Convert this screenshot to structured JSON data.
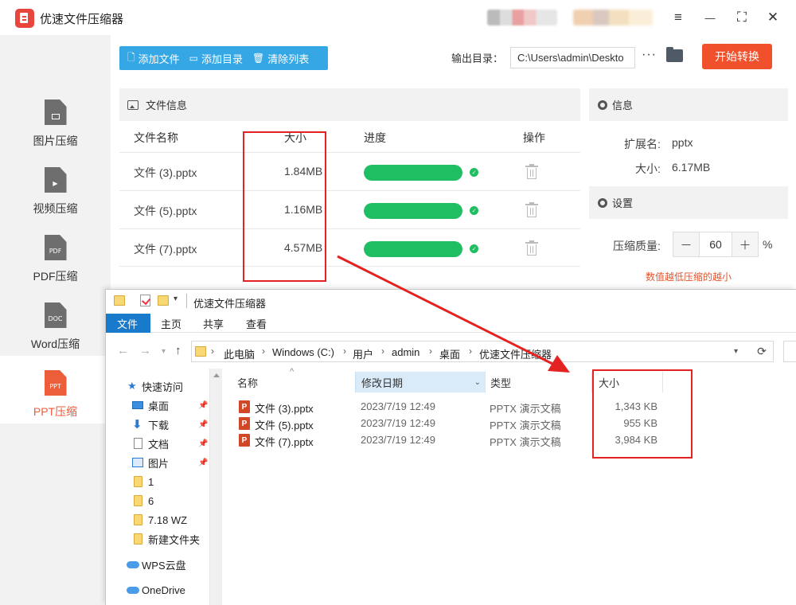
{
  "app": {
    "title": "优速文件压缩器",
    "window_controls": {
      "menu": "≡",
      "minimize": "—",
      "fullscreen": "⛶",
      "close": "✕"
    }
  },
  "sidebar": {
    "items": [
      {
        "label": "图片压缩",
        "icon": "image-file-icon",
        "tag": "",
        "active": false
      },
      {
        "label": "视频压缩",
        "icon": "video-file-icon",
        "tag": "▶",
        "active": false
      },
      {
        "label": "PDF压缩",
        "icon": "pdf-file-icon",
        "tag": "PDF",
        "active": false
      },
      {
        "label": "Word压缩",
        "icon": "word-file-icon",
        "tag": "DOC",
        "active": false
      },
      {
        "label": "PPT压缩",
        "icon": "ppt-file-icon",
        "tag": "PPT",
        "active": true
      }
    ]
  },
  "toolbar": {
    "add_file": "添加文件",
    "add_dir": "添加目录",
    "clear_list": "清除列表",
    "output_label": "输出目录：",
    "output_path": "C:\\Users\\admin\\Deskto",
    "more": "···",
    "start": "开始转换"
  },
  "file_panel": {
    "title": "文件信息",
    "columns": {
      "name": "文件名称",
      "size": "大小",
      "progress": "进度",
      "action": "操作"
    },
    "rows": [
      {
        "name": "文件 (3).pptx",
        "size": "1.84MB",
        "progress": 1.0
      },
      {
        "name": "文件 (5).pptx",
        "size": "1.16MB",
        "progress": 1.0
      },
      {
        "name": "文件 (7).pptx",
        "size": "4.57MB",
        "progress": 1.0
      }
    ]
  },
  "info_panel": {
    "title": "信息",
    "ext_label": "扩展名:",
    "ext_value": "pptx",
    "size_label": "大小:",
    "size_value": "6.17MB"
  },
  "settings_panel": {
    "title": "设置",
    "quality_label": "压缩质量:",
    "quality_value": "60",
    "minus": "－",
    "plus": "＋",
    "percent": "%",
    "hint": "数值越低压缩的越小"
  },
  "explorer": {
    "title": "优速文件压缩器",
    "ribbon_tabs": [
      "文件",
      "主页",
      "共享",
      "查看"
    ],
    "breadcrumb": [
      "此电脑",
      "Windows (C:)",
      "用户",
      "admin",
      "桌面",
      "优速文件压缩器"
    ],
    "nav_items": [
      {
        "label": "快速访问",
        "icon": "star-icon",
        "pinned": false
      },
      {
        "label": "桌面",
        "icon": "desktop-icon",
        "pinned": true
      },
      {
        "label": "下载",
        "icon": "download-icon",
        "pinned": true
      },
      {
        "label": "文档",
        "icon": "documents-icon",
        "pinned": true
      },
      {
        "label": "图片",
        "icon": "pictures-icon",
        "pinned": true
      },
      {
        "label": "1",
        "icon": "folder-icon",
        "pinned": false
      },
      {
        "label": "6",
        "icon": "folder-icon",
        "pinned": false
      },
      {
        "label": "7.18 WZ",
        "icon": "folder-icon",
        "pinned": false
      },
      {
        "label": "新建文件夹",
        "icon": "folder-icon",
        "pinned": false
      },
      {
        "label": "WPS云盘",
        "icon": "cloud-icon",
        "pinned": false
      },
      {
        "label": "OneDrive",
        "icon": "cloud-icon",
        "pinned": false
      }
    ],
    "columns": {
      "name": "名称",
      "date": "修改日期",
      "type": "类型",
      "size": "大小"
    },
    "files": [
      {
        "name": "文件 (3).pptx",
        "date": "2023/7/19 12:49",
        "type": "PPTX 演示文稿",
        "size": "1,343 KB"
      },
      {
        "name": "文件 (5).pptx",
        "date": "2023/7/19 12:49",
        "type": "PPTX 演示文稿",
        "size": "955 KB"
      },
      {
        "name": "文件 (7).pptx",
        "date": "2023/7/19 12:49",
        "type": "PPTX 演示文稿",
        "size": "3,984 KB"
      }
    ]
  },
  "colors": {
    "accent_blue": "#35a7e5",
    "start_orange": "#f0502b",
    "progress_green": "#1fbe62",
    "annotation_red": "#e42222",
    "ribbon_blue": "#1979ca"
  }
}
